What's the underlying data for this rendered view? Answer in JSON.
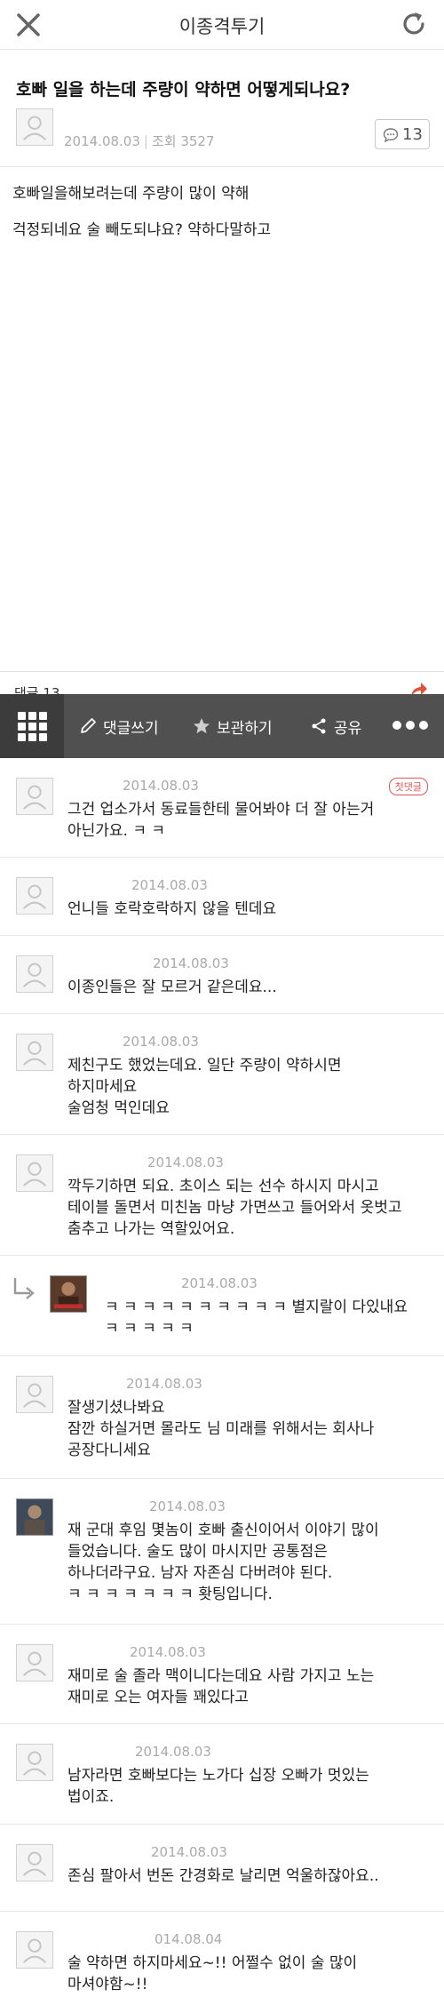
{
  "header": {
    "title": "이종격투기",
    "close_icon": "close-icon",
    "refresh_icon": "refresh-icon"
  },
  "post": {
    "title": "호빠 일을 하는데 주량이 약하면 어떻게되나요?",
    "date": "2014.08.03",
    "views_label": "조회 3527",
    "comment_count": "13",
    "body": [
      "호빠일을해보려는데 주량이 많이 약해",
      "걱정되네요 술 빼도되냐요? 약하다말하고"
    ]
  },
  "reply_strip": {
    "label": "댓글 13"
  },
  "toolbar": {
    "write_label": "댓글쓰기",
    "save_label": "보관하기",
    "share_label": "공유",
    "colors": {
      "bar": "#505050",
      "grid": "#3c3c3c"
    }
  },
  "first_comment_badge": "첫댓글",
  "comments": [
    {
      "date": "2014.08.03",
      "lines": [
        "그건 업소가서 동료들한테 물어봐야 더 잘 아는거",
        "아닌가요. ㅋ ㅋ"
      ]
    },
    {
      "date": "2014.08.03",
      "lines": [
        "언니들 호락호락하지 않을 텐데요"
      ]
    },
    {
      "date": "2014.08.03",
      "lines": [
        "이종인들은 잘 모르거 같은데요..."
      ]
    },
    {
      "date": "2014.08.03",
      "lines": [
        "제친구도 했었는데요. 일단 주량이 약하시면",
        "하지마세요",
        "술엄청 먹인데요"
      ]
    },
    {
      "date": "2014.08.03",
      "lines": [
        "깍두기하면 되요. 초이스 되는 선수 하시지 마시고",
        "테이블 돌면서 미친놈 마냥 가면쓰고 들어와서 옷벗고",
        "춤추고 나가는 역할있어요."
      ]
    },
    {
      "date": "2014.08.03",
      "lines": [
        "ㅋ ㅋ ㅋ ㅋ ㅋ ㅋ ㅋ ㅋ ㅋ ㅋ  별지랄이 다있내요",
        "ㅋ ㅋ ㅋ ㅋ ㅋ"
      ]
    },
    {
      "date": "2014.08.03",
      "lines": [
        "잘생기셨나봐요",
        "잠깐 하실거면 몰라도 님 미래를 위해서는 회사나",
        "공장다니세요"
      ]
    },
    {
      "date": "2014.08.03",
      "lines": [
        "재 군대 후임 몇놈이 호빠 출신이어서 이야기 많이",
        "들었습니다. 술도 많이 마시지만 공통점은",
        "하나더라구요. 남자 자존심 다버려야 된다.",
        "ㅋ ㅋ ㅋ ㅋ ㅋ ㅋ ㅋ  홧팅입니다."
      ]
    },
    {
      "date": "2014.08.03",
      "lines": [
        "재미로 술 졸라 맥이니다는데요 사람 가지고 노는",
        "재미로 오는 여자들 꽤있다고"
      ]
    },
    {
      "date": "2014.08.03",
      "lines": [
        "남자라면 호빠보다는 노가다 십장 오빠가 멋있는",
        "법이죠."
      ]
    },
    {
      "date": "2014.08.03",
      "lines": [
        "존심 팔아서 번돈 간경화로 날리면 억울하잖아요.."
      ]
    },
    {
      "date": "014.08.04",
      "lines": [
        "술 약하면 하지마세요~!! 어쩔수 없이 술 많이",
        "마셔야함~!!"
      ]
    }
  ]
}
